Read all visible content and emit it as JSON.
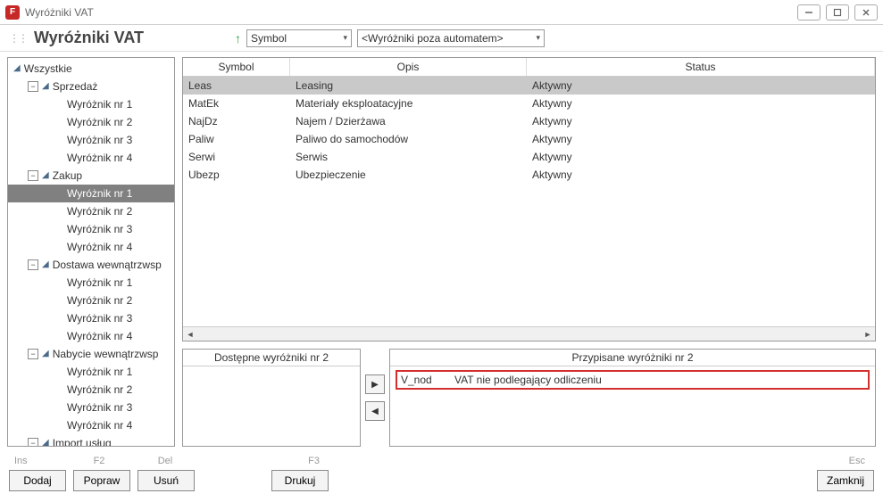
{
  "window": {
    "title": "Wyróżniki VAT",
    "appicon_letter": "F"
  },
  "toolbar": {
    "heading": "Wyróżniki VAT",
    "sort_field": "Symbol",
    "filter_value": "<Wyróżniki poza automatem>"
  },
  "tree": [
    {
      "level": 0,
      "expander": "blank",
      "tri": true,
      "label": "Wszystkie"
    },
    {
      "level": 1,
      "expander": "minus",
      "tri": true,
      "label": "Sprzedaż"
    },
    {
      "level": 2,
      "expander": "none",
      "tri": false,
      "label": "Wyróżnik nr 1"
    },
    {
      "level": 2,
      "expander": "none",
      "tri": false,
      "label": "Wyróżnik nr 2"
    },
    {
      "level": 2,
      "expander": "none",
      "tri": false,
      "label": "Wyróżnik nr 3"
    },
    {
      "level": 2,
      "expander": "none",
      "tri": false,
      "label": "Wyróżnik nr 4"
    },
    {
      "level": 1,
      "expander": "minus",
      "tri": true,
      "label": "Zakup"
    },
    {
      "level": 2,
      "expander": "none",
      "tri": false,
      "label": "Wyróżnik nr 1",
      "selected": true
    },
    {
      "level": 2,
      "expander": "none",
      "tri": false,
      "label": "Wyróżnik nr 2"
    },
    {
      "level": 2,
      "expander": "none",
      "tri": false,
      "label": "Wyróżnik nr 3"
    },
    {
      "level": 2,
      "expander": "none",
      "tri": false,
      "label": "Wyróżnik nr 4"
    },
    {
      "level": 1,
      "expander": "minus",
      "tri": true,
      "label": "Dostawa wewnątrzwsp"
    },
    {
      "level": 2,
      "expander": "none",
      "tri": false,
      "label": "Wyróżnik nr 1"
    },
    {
      "level": 2,
      "expander": "none",
      "tri": false,
      "label": "Wyróżnik nr 2"
    },
    {
      "level": 2,
      "expander": "none",
      "tri": false,
      "label": "Wyróżnik nr 3"
    },
    {
      "level": 2,
      "expander": "none",
      "tri": false,
      "label": "Wyróżnik nr 4"
    },
    {
      "level": 1,
      "expander": "minus",
      "tri": true,
      "label": "Nabycie wewnątrzwsp"
    },
    {
      "level": 2,
      "expander": "none",
      "tri": false,
      "label": "Wyróżnik nr 1"
    },
    {
      "level": 2,
      "expander": "none",
      "tri": false,
      "label": "Wyróżnik nr 2"
    },
    {
      "level": 2,
      "expander": "none",
      "tri": false,
      "label": "Wyróżnik nr 3"
    },
    {
      "level": 2,
      "expander": "none",
      "tri": false,
      "label": "Wyróżnik nr 4"
    },
    {
      "level": 1,
      "expander": "minus",
      "tri": true,
      "label": "Import usług"
    }
  ],
  "grid": {
    "columns": {
      "symbol": "Symbol",
      "desc": "Opis",
      "status": "Status"
    },
    "rows": [
      {
        "symbol": "Leas",
        "desc": "Leasing",
        "status": "Aktywny",
        "selected": true
      },
      {
        "symbol": "MatEk",
        "desc": "Materiały eksploatacyjne",
        "status": "Aktywny"
      },
      {
        "symbol": "NajDz",
        "desc": "Najem / Dzierżawa",
        "status": "Aktywny"
      },
      {
        "symbol": "Paliw",
        "desc": "Paliwo do samochodów",
        "status": "Aktywny"
      },
      {
        "symbol": "Serwi",
        "desc": "Serwis",
        "status": "Aktywny"
      },
      {
        "symbol": "Ubezp",
        "desc": "Ubezpieczenie",
        "status": "Aktywny"
      }
    ]
  },
  "dual": {
    "available_header": "Dostępne wyróżniki nr 2",
    "assigned_header": "Przypisane wyróżniki nr 2",
    "assigned": [
      {
        "code": "V_nod",
        "desc": "VAT nie podlegający odliczeniu"
      }
    ]
  },
  "footer": {
    "shortcuts": {
      "ins": "Ins",
      "f2": "F2",
      "del": "Del",
      "f3": "F3",
      "esc": "Esc"
    },
    "buttons": {
      "dodaj": "Dodaj",
      "popraw": "Popraw",
      "usun": "Usuń",
      "drukuj": "Drukuj",
      "zamknij": "Zamknij"
    }
  }
}
